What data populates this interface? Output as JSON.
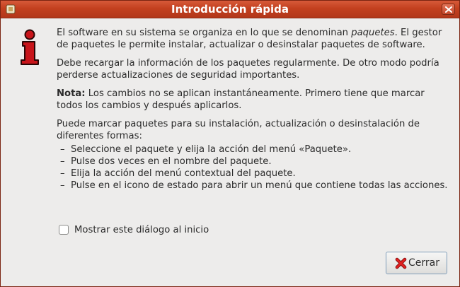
{
  "window": {
    "title": "Introducción rápida"
  },
  "paragraphs": {
    "p1_a": "El software en su sistema se organiza en lo que se denominan ",
    "p1_em": "paquetes",
    "p1_b": ". El gestor de paquetes le permite instalar, actualizar o desinstalar paquetes de software.",
    "p2": "Debe recargar la información de los paquetes regularmente. De otro modo podría perderse actualizaciones de seguridad importantes.",
    "p3_bold": "Nota:",
    "p3": " Los cambios no se aplican instantáneamente. Primero tiene que marcar todos los cambios y después aplicarlos.",
    "p4": "Puede marcar paquetes para su instalación, actualización o desinstalación de diferentes formas:"
  },
  "bullets": [
    "Seleccione el paquete y elija la acción del menú «Paquete».",
    "Pulse dos veces en el nombre del paquete.",
    "Elija la acción del menú contextual del paquete.",
    "Pulse en el icono de estado para abrir un menú que contiene todas las acciones."
  ],
  "bullet_marker": "–",
  "checkbox": {
    "label": "Mostrar este diálogo al inicio",
    "checked": false
  },
  "buttons": {
    "close_label": "Cerrar"
  },
  "icons": {
    "app": "app-icon",
    "title_close": "close-icon",
    "info": "info-icon",
    "cerrar": "cancel-x-icon"
  },
  "colors": {
    "titlebar": "#c3401f",
    "info_icon": "#c8141a",
    "cerrar_x": "#d01818"
  }
}
